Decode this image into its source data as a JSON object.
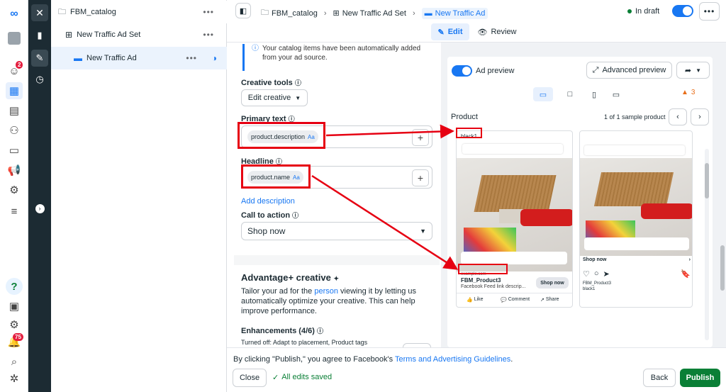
{
  "rail": {
    "notif_badge": "2",
    "alerts_badge": "75"
  },
  "tree": {
    "items": [
      {
        "label": "FBM_catalog"
      },
      {
        "label": "New Traffic Ad Set"
      },
      {
        "label": "New Traffic Ad"
      }
    ]
  },
  "header": {
    "breadcrumb": [
      "FBM_catalog",
      "New Traffic Ad Set",
      "New Traffic Ad"
    ],
    "status": "In draft",
    "tab_edit": "Edit",
    "tab_review": "Review"
  },
  "form": {
    "info_text": "Your catalog items have been automatically added from your ad source.",
    "creative_tools_label": "Creative tools",
    "edit_creative": "Edit creative",
    "primary_text_label": "Primary text",
    "primary_text_token": "product.description",
    "headline_label": "Headline",
    "headline_token": "product.name",
    "token_suffix": "Aa",
    "add_description": "Add description",
    "cta_label": "Call to action",
    "cta_value": "Shop now",
    "adv_title": "Advantage+ creative",
    "adv_desc_1": "Tailor your ad for the ",
    "adv_desc_link": "person",
    "adv_desc_2": " viewing it by letting us automatically optimize your creative. This can help improve performance.",
    "enh_label": "Enhancements (4/6)",
    "enh_off": "Turned off: Adapt to placement, Product tags"
  },
  "preview": {
    "ad_preview": "Ad preview",
    "advanced_preview": "Advanced preview",
    "warning_count": "3",
    "product_label": "Product",
    "sample_count": "1 of 1 sample product",
    "card1": {
      "primary_text": "black1",
      "url": "example.com",
      "headline": "FBM_Product3",
      "description": "Facebook Feed link descrip...",
      "cta": "Shop now",
      "actions": [
        "Like",
        "Comment",
        "Share"
      ]
    },
    "card2": {
      "cta": "Shop now",
      "name": "FBM_Product3",
      "desc": "black1"
    }
  },
  "bottom": {
    "notice_prefix": "By clicking \"Publish,\" you agree to Facebook's ",
    "notice_link": "Terms and Advertising Guidelines",
    "notice_suffix": ".",
    "close": "Close",
    "saved": "All edits saved",
    "back": "Back",
    "publish": "Publish"
  },
  "colors": {
    "accent": "#1877f2",
    "publish": "#0a7f36",
    "red_annotation": "#e60012"
  }
}
